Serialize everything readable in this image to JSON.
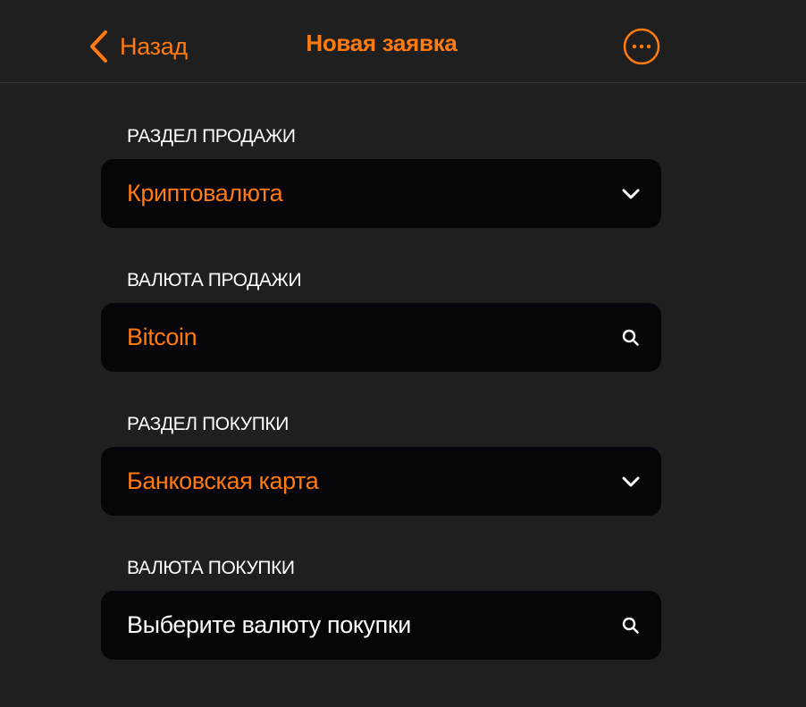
{
  "colors": {
    "accent": "#ff7a0f",
    "background": "#1f1f1f",
    "field_background": "#05050a",
    "text": "#ffffff"
  },
  "header": {
    "back_label": "Назад",
    "back_icon": "chevron-left-icon",
    "title": "Новая заявка",
    "more_icon": "more-horizontal-circle-icon"
  },
  "form": {
    "sell_section": {
      "label": "РАЗДЕЛ ПРОДАЖИ",
      "value": "Криптовалюта",
      "icon": "chevron-down-icon"
    },
    "sell_currency": {
      "label": "ВАЛЮТА ПРОДАЖИ",
      "value": "Bitcoin",
      "icon": "search-icon"
    },
    "buy_section": {
      "label": "РАЗДЕЛ ПОКУПКИ",
      "value": "Банковская карта",
      "icon": "chevron-down-icon"
    },
    "buy_currency": {
      "label": "ВАЛЮТА ПОКУПКИ",
      "placeholder": "Выберите валюту покупки",
      "icon": "search-icon"
    }
  }
}
